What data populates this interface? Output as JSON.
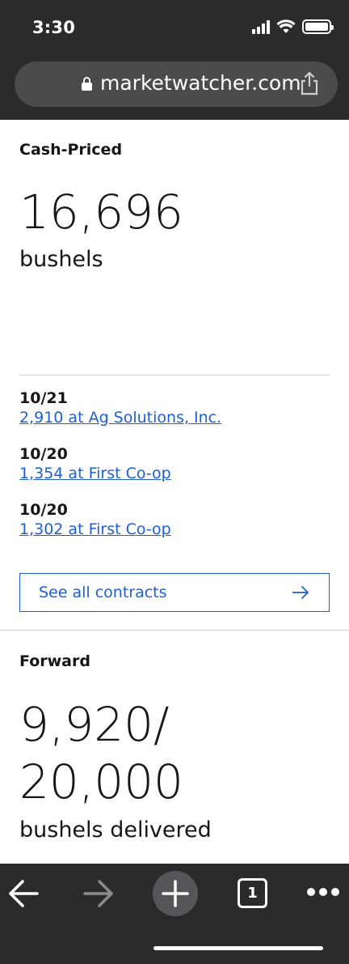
{
  "status_bar": {
    "time": "3:30"
  },
  "browser": {
    "url": "marketwatcher.com"
  },
  "cash_priced": {
    "title": "Cash-Priced",
    "value": "16,696",
    "unit": "bushels",
    "contracts": [
      {
        "date": "10/21",
        "text": "2,910 at Ag Solutions, Inc."
      },
      {
        "date": "10/20",
        "text": "1,354 at First Co-op"
      },
      {
        "date": "10/20",
        "text": "1,302 at First Co-op"
      }
    ],
    "see_all_label": "See all contracts"
  },
  "forward": {
    "title": "Forward",
    "value_line1": "9,920/",
    "value_line2": "20,000",
    "unit": "bushels delivered"
  },
  "toolbar": {
    "tab_count": "1"
  },
  "colors": {
    "link": "#1f5fd1",
    "chrome": "#2b2b2d",
    "url_bar": "#4b4b4e"
  }
}
